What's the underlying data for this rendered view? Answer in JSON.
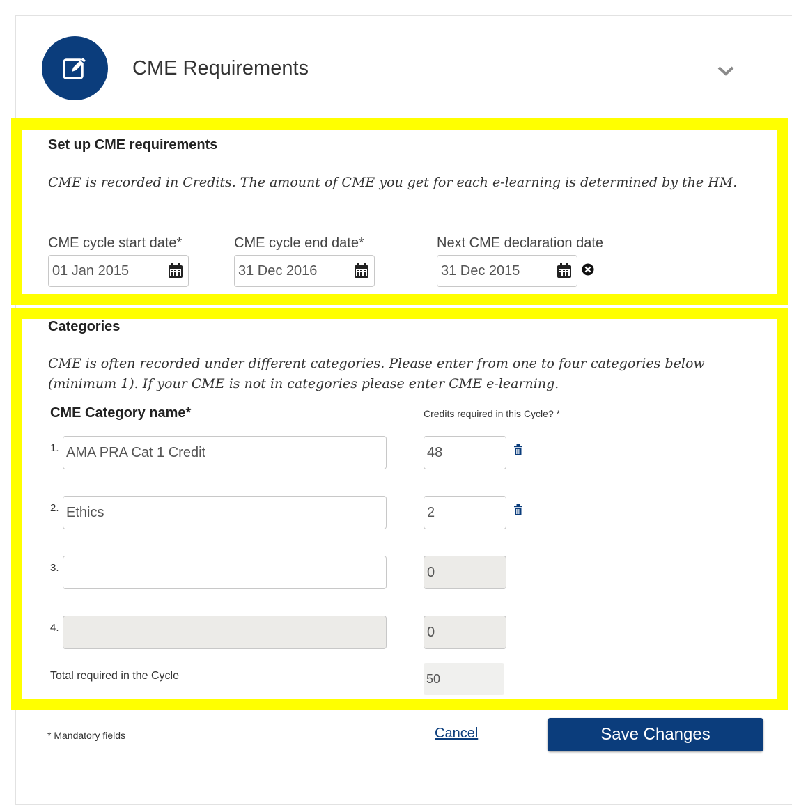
{
  "header": {
    "icon": "edit-icon",
    "title": "CME Requirements",
    "toggle_icon": "chevron-down-icon"
  },
  "setup": {
    "title": "Set up CME requirements",
    "intro": "CME is recorded in Credits. The amount of CME you get for each e-learning is determined by the HM.",
    "start": {
      "label": "CME cycle start date*",
      "value": "01 Jan 2015"
    },
    "end": {
      "label": "CME cycle end date*",
      "value": "31 Dec 2016"
    },
    "declaration": {
      "label": "Next CME declaration date",
      "value": "31 Dec 2015"
    }
  },
  "categories": {
    "title": "Categories",
    "intro": "CME is often recorded under different categories. Please enter from one to four categories below (minimum 1). If your CME is not in categories please enter CME e-learning.",
    "name_header": "CME Category name*",
    "credits_header": "Credits required in this Cycle? *",
    "rows": [
      {
        "num": "1.",
        "name": "AMA PRA Cat 1 Credit",
        "credits": "48",
        "enabled": true,
        "deletable": true
      },
      {
        "num": "2.",
        "name": "Ethics",
        "credits": "2",
        "enabled": true,
        "deletable": true
      },
      {
        "num": "3.",
        "name": "",
        "credits": "0",
        "enabled": true,
        "deletable": false
      },
      {
        "num": "4.",
        "name": "",
        "credits": "0",
        "enabled": false,
        "deletable": false
      }
    ],
    "total_label": "Total required in the Cycle",
    "total_value": "50"
  },
  "footer": {
    "mandatory": "* Mandatory fields",
    "cancel": "Cancel",
    "save": "Save Changes"
  },
  "colors": {
    "brand": "#0b3d7c",
    "highlight": "#ffff00",
    "disabled_field": "#ecebe8"
  }
}
